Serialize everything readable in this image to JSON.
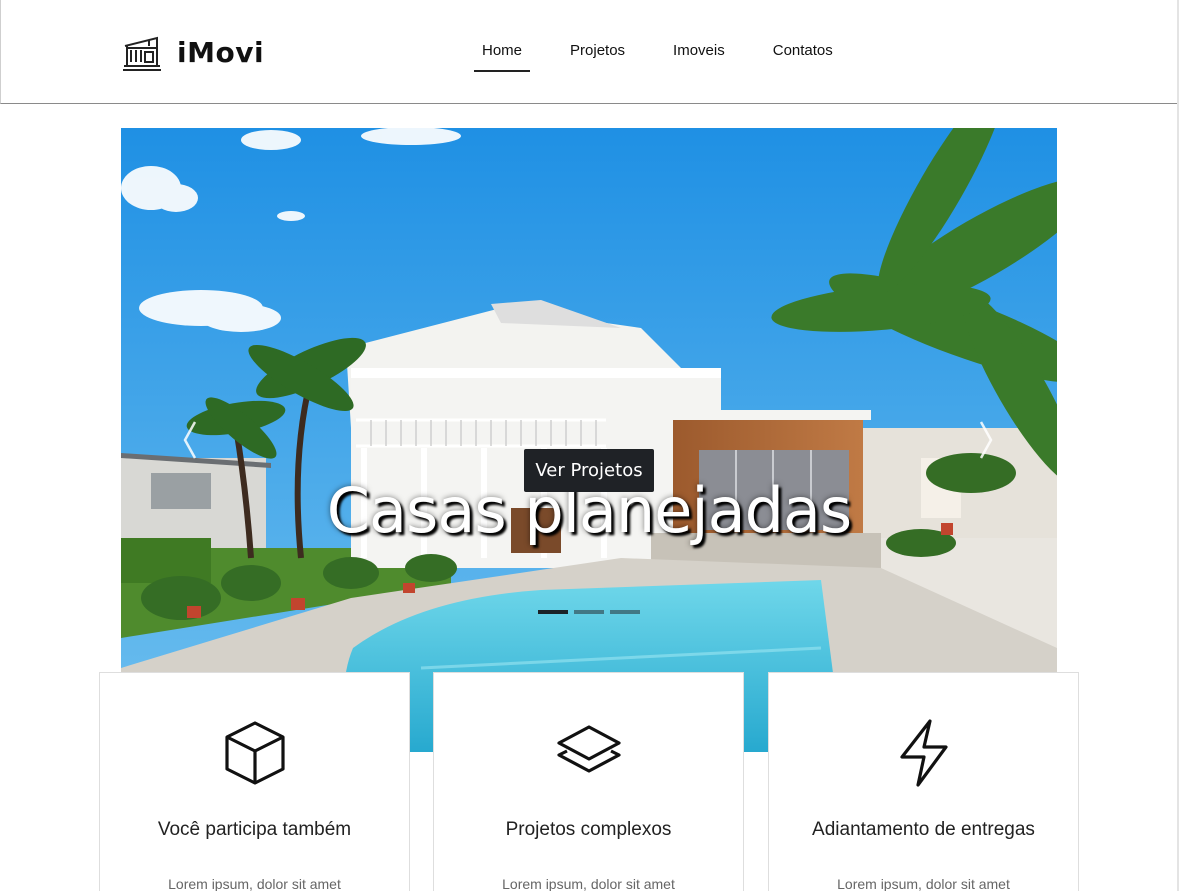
{
  "brand": {
    "name": "iMovi",
    "icon": "house-building-icon"
  },
  "nav": {
    "items": [
      {
        "label": "Home",
        "active": true
      },
      {
        "label": "Projetos",
        "active": false
      },
      {
        "label": "Imoveis",
        "active": false
      },
      {
        "label": "Contatos",
        "active": false
      }
    ]
  },
  "hero": {
    "title": "Casas planejadas",
    "button_label": "Ver Projetos",
    "slide_count": 3,
    "active_slide": 1,
    "image": "house-with-pool-photo"
  },
  "features": [
    {
      "icon": "cube-icon",
      "title": "Você participa também",
      "text": "Lorem ipsum, dolor sit amet"
    },
    {
      "icon": "layers-icon",
      "title": "Projetos complexos",
      "text": "Lorem ipsum, dolor sit amet"
    },
    {
      "icon": "lightning-icon",
      "title": "Adiantamento de entregas",
      "text": "Lorem ipsum, dolor sit amet"
    }
  ],
  "colors": {
    "sky": "#2c9be6",
    "pool": "#4cc4e0",
    "dark_button": "#1f2226",
    "text": "#222222"
  }
}
